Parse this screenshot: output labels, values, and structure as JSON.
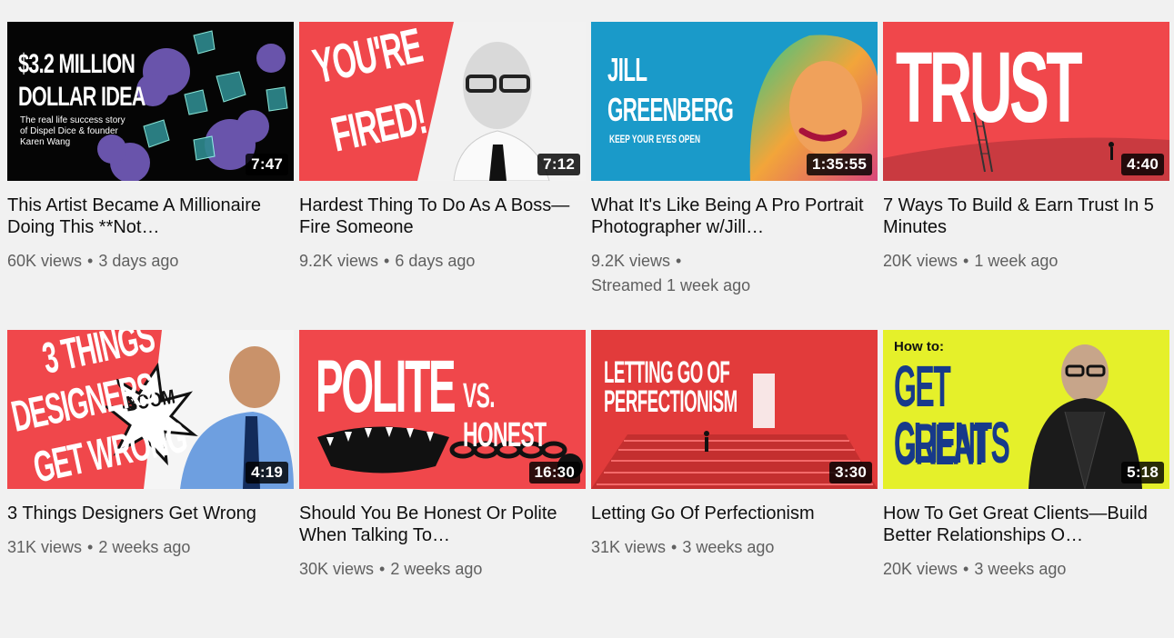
{
  "videos": [
    {
      "title": "This Artist Became A Millionaire Doing This **Not…",
      "views": "60K views",
      "age": "3 days ago",
      "duration": "7:47",
      "thumb": {
        "line1": "$3.2 MILLION",
        "line2": "DOLLAR IDEA",
        "sub1": "The real life success story",
        "sub2": "of Dispel Dice & founder",
        "sub3": "Karen Wang"
      }
    },
    {
      "title": "Hardest Thing To Do As A Boss—Fire Someone",
      "views": "9.2K views",
      "age": "6 days ago",
      "duration": "7:12",
      "thumb": {
        "line1": "YOU'RE",
        "line2": "FIRED!"
      }
    },
    {
      "title": "What It's Like Being A Pro Portrait Photographer w/Jill…",
      "views": "9.2K views",
      "age": "Streamed 1 week ago",
      "duration": "1:35:55",
      "thumb": {
        "line1": "JILL",
        "line2": "GREENBERG",
        "sub1": "KEEP YOUR EYES OPEN"
      }
    },
    {
      "title": "7 Ways To Build & Earn Trust In 5 Minutes",
      "views": "20K views",
      "age": "1 week ago",
      "duration": "4:40",
      "thumb": {
        "line1": "TRUST"
      }
    },
    {
      "title": "3 Things Designers Get Wrong",
      "views": "31K views",
      "age": "2 weeks ago",
      "duration": "4:19",
      "thumb": {
        "line1": "3 THINGS",
        "line2": "DESIGNERS",
        "line3": "GET WRONG",
        "burst": "BOOM"
      }
    },
    {
      "title": "Should You Be Honest Or Polite When Talking To…",
      "views": "30K views",
      "age": "2 weeks ago",
      "duration": "16:30",
      "thumb": {
        "line1": "POLITE",
        "line2": "VS. HONEST"
      }
    },
    {
      "title": "Letting Go Of Perfectionism",
      "views": "31K views",
      "age": "3 weeks ago",
      "duration": "3:30",
      "thumb": {
        "line1": "LETTING GO OF",
        "line2": "PERFECTIONISM"
      }
    },
    {
      "title": "How To Get Great Clients—Build Better Relationships O…",
      "views": "20K views",
      "age": "3 weeks ago",
      "duration": "5:18",
      "thumb": {
        "line1": "How to:",
        "line2": "GET GREAT",
        "line3": "CLIENTS"
      }
    }
  ],
  "colors": {
    "background": "#f1f1f1",
    "brand_red": "#f0474b",
    "title": "#0f0f0f",
    "meta": "#606060",
    "duration_bg": "#000000",
    "jill_blue": "#1a9ac9",
    "clients_yellow": "#e5f02a"
  }
}
